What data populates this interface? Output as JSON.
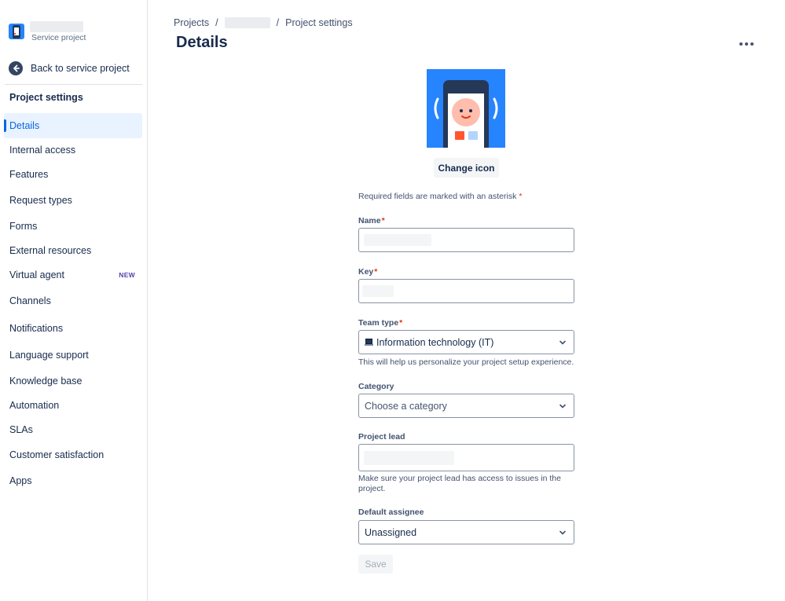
{
  "sidebar": {
    "project_type": "Service project",
    "back_label": "Back to service project",
    "heading": "Project settings",
    "items": [
      {
        "label": "Details",
        "active": true
      },
      {
        "label": "Internal access"
      },
      {
        "label": "Features"
      },
      {
        "label": "Request types"
      },
      {
        "label": "Forms"
      },
      {
        "label": "External resources"
      },
      {
        "label": "Virtual agent",
        "badge": "NEW"
      },
      {
        "label": "Channels"
      },
      {
        "label": "Notifications"
      },
      {
        "label": "Language support"
      },
      {
        "label": "Knowledge base"
      },
      {
        "label": "Automation"
      },
      {
        "label": "SLAs"
      },
      {
        "label": "Customer satisfaction"
      },
      {
        "label": "Apps"
      }
    ]
  },
  "breadcrumb": {
    "projects": "Projects",
    "separator": "/",
    "current": "Project settings"
  },
  "page": {
    "title": "Details",
    "more_icon": "more-horizontal-icon"
  },
  "form": {
    "change_icon_label": "Change icon",
    "required_note": "Required fields are marked with an asterisk",
    "asterisk": "*",
    "name_label": "Name",
    "key_label": "Key",
    "team_type_label": "Team type",
    "team_type_value": "Information technology (IT)",
    "team_type_helper": "This will help us personalize your project setup experience.",
    "category_label": "Category",
    "category_placeholder": "Choose a category",
    "project_lead_label": "Project lead",
    "project_lead_helper": "Make sure your project lead has access to issues in the project.",
    "default_assignee_label": "Default assignee",
    "default_assignee_value": "Unassigned",
    "save_label": "Save"
  },
  "colors": {
    "accent": "#0c66e4",
    "required": "#de350b",
    "avatar_bg": "#2684ff"
  }
}
